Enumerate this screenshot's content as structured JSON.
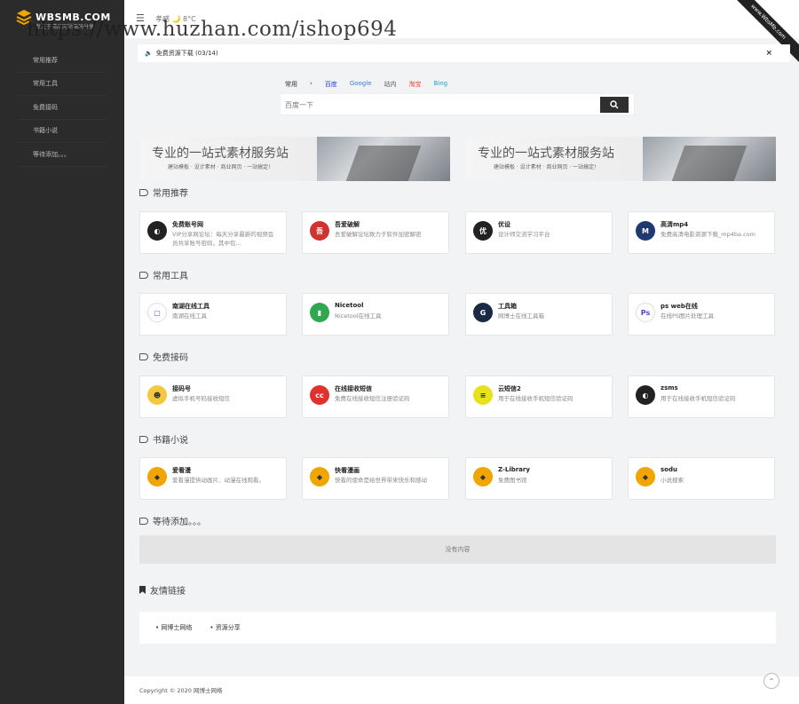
{
  "logo": {
    "text": "WBSMB.COM",
    "sub": "专注于精品网站源码分享"
  },
  "watermark": "https://www.huzhan.com/ishop694",
  "sidebar": {
    "items": [
      {
        "label": "常用推荐"
      },
      {
        "label": "常用工具"
      },
      {
        "label": "免费接码"
      },
      {
        "label": "书籍小说"
      },
      {
        "label": "等待添加。。。"
      }
    ]
  },
  "header": {
    "menu_icon": "menu-icon",
    "weather": "孝感 🌙 8°C",
    "ribbon": "www.WbsMb.com"
  },
  "notice": {
    "text": "免费资源下载 (03/14)",
    "close": "×"
  },
  "search": {
    "tabs": [
      {
        "label": "常用",
        "color": "#333333"
      },
      {
        "label": "›",
        "color": "#333333"
      },
      {
        "label": "百度",
        "color": "#2a3bd6"
      },
      {
        "label": "Google",
        "color": "#3a7bd5"
      },
      {
        "label": "站内",
        "color": "#555555"
      },
      {
        "label": "淘宝",
        "color": "#e8432a"
      },
      {
        "label": "Bing",
        "color": "#1aa1c9"
      }
    ],
    "placeholder": "百度一下"
  },
  "banners": [
    {
      "title": "专业的一站式素材服务站",
      "sub": "建站模板 · 设计素材 · 商业网页 · 一站搞定!"
    },
    {
      "title": "专业的一站式素材服务站",
      "sub": "建站模板 · 设计素材 · 商业网页 · 一站搞定!"
    }
  ],
  "sections": [
    {
      "title": "常用推荐",
      "cards": [
        {
          "title": "免费账号网",
          "desc": "VIP分享网论坛：每天分享最新的视频会员共享账号密码，其中包...",
          "icon": "globe-icon",
          "color": "#222222"
        },
        {
          "title": "吾爱破解",
          "desc": "吾爱破解论坛致力于软件加密解密",
          "icon": "52pojie-icon",
          "color": "#d3332f"
        },
        {
          "title": "优设",
          "desc": "设计师交流学习平台",
          "icon": "uisdc-icon",
          "color": "#222222"
        },
        {
          "title": "高清mp4",
          "desc": "免费高清电影资源下载_mp4ba.com",
          "icon": "m-icon",
          "color": "#1f3a6e"
        }
      ]
    },
    {
      "title": "常用工具",
      "cards": [
        {
          "title": "南湖在线工具",
          "desc": "南湖在线工具",
          "icon": "tool-icon",
          "color": "#ffffff"
        },
        {
          "title": "Nicetool",
          "desc": "Nicetool在线工具",
          "icon": "nicetool-icon",
          "color": "#2fa84f"
        },
        {
          "title": "工具箱",
          "desc": "网博士在线工具箱",
          "icon": "g-icon",
          "color": "#1b2a44"
        },
        {
          "title": "ps web在线",
          "desc": "在线PS图片处理工具",
          "icon": "ps-icon",
          "color": "#ffffff"
        }
      ]
    },
    {
      "title": "免费接码",
      "cards": [
        {
          "title": "接码号",
          "desc": "虚拟手机号码接收短信",
          "icon": "mascot-icon",
          "color": "#f5c842"
        },
        {
          "title": "在线接收短信",
          "desc": "免费在线接收短信注册验证码",
          "icon": "cc-icon",
          "color": "#e0312f"
        },
        {
          "title": "云短信2",
          "desc": "用于在线接收手机短信验证码",
          "icon": "chat-icon",
          "color": "#e6e21c"
        },
        {
          "title": "zsms",
          "desc": "用于在线接收手机短信验证码",
          "icon": "globe-icon",
          "color": "#222222"
        }
      ]
    },
    {
      "title": "书籍小说",
      "cards": [
        {
          "title": "爱看漫",
          "desc": "爱看漫提供动画片、动漫在线观看。",
          "icon": "layers-icon",
          "color": "#f0a500"
        },
        {
          "title": "快看漫画",
          "desc": "快看的使命是给世界带来快乐和感动",
          "icon": "layers-icon",
          "color": "#f0a500"
        },
        {
          "title": "Z-Library",
          "desc": "免费图书馆",
          "icon": "layers-icon",
          "color": "#f0a500"
        },
        {
          "title": "sodu",
          "desc": "小说搜索",
          "icon": "layers-icon",
          "color": "#f0a500"
        }
      ]
    },
    {
      "title": "等待添加。。。",
      "cards": []
    }
  ],
  "empty_text": "没有内容",
  "friend_links": {
    "title": "友情链接",
    "items": [
      "网博士网络",
      "资源分享"
    ]
  },
  "footer": {
    "copyright": "Copyright © 2020 网博士网络",
    "top_icon": "arrow-up-icon"
  }
}
